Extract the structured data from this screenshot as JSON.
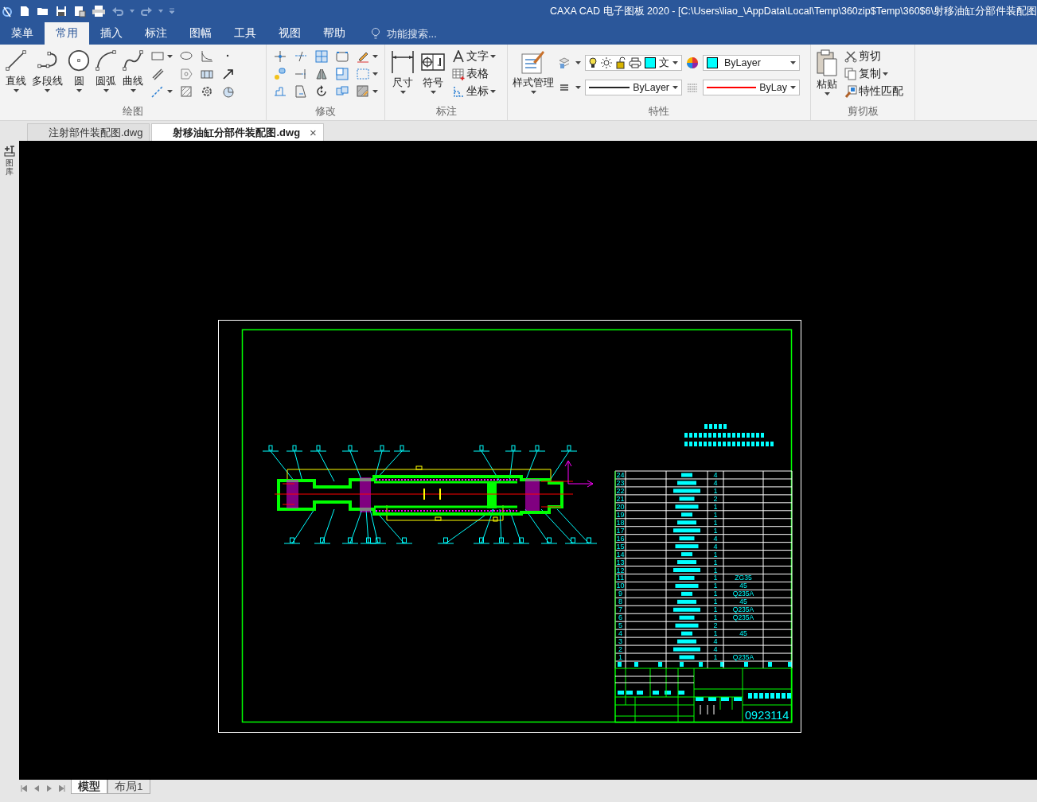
{
  "window": {
    "title": "CAXA CAD 电子图板 2020 - [C:\\Users\\liao_\\AppData\\Local\\Temp\\360zip$Temp\\360$6\\射移油缸分部件装配图"
  },
  "ribbon_tabs": [
    {
      "label": "菜单",
      "selected": false
    },
    {
      "label": "常用",
      "selected": true
    },
    {
      "label": "插入",
      "selected": false
    },
    {
      "label": "标注",
      "selected": false
    },
    {
      "label": "图幅",
      "selected": false
    },
    {
      "label": "工具",
      "selected": false
    },
    {
      "label": "视图",
      "selected": false
    },
    {
      "label": "帮助",
      "selected": false
    }
  ],
  "search": {
    "placeholder": "功能搜索..."
  },
  "draw_group": {
    "label": "绘图",
    "tools": [
      "直线",
      "多段线",
      "圆",
      "圆弧",
      "曲线"
    ]
  },
  "modify_group": {
    "label": "修改"
  },
  "annotate_group": {
    "label": "标注",
    "tools": [
      "尺寸",
      "符号"
    ],
    "small_tools": [
      "文字",
      "表格",
      "坐标"
    ]
  },
  "properties_group": {
    "label": "特性",
    "tools": [
      "样式管理"
    ],
    "layer": {
      "value": "文",
      "color": "#00ffff"
    },
    "color": {
      "value": "ByLayer",
      "color": "#00ffff"
    },
    "linetype": {
      "value": "ByLayer"
    },
    "lineweight": {
      "value": "ByLay",
      "color": "#ff0000"
    }
  },
  "clipboard_group": {
    "label": "剪切板",
    "tools": [
      "粘贴"
    ],
    "small_tools": [
      "剪切",
      "复制",
      "特性匹配"
    ]
  },
  "document_tabs": [
    {
      "label": "注射部件装配图.dwg",
      "selected": false
    },
    {
      "label": "射移油缸分部件装配图.dwg",
      "selected": true,
      "close": "×"
    }
  ],
  "side_panel": {
    "label": "图库"
  },
  "parts_list": {
    "rows": [
      {
        "no": "24",
        "qty": "4"
      },
      {
        "no": "23",
        "qty": "4"
      },
      {
        "no": "22",
        "qty": "1"
      },
      {
        "no": "21",
        "qty": "2"
      },
      {
        "no": "20",
        "qty": "1"
      },
      {
        "no": "19",
        "qty": "1"
      },
      {
        "no": "18",
        "qty": "1"
      },
      {
        "no": "17",
        "qty": "1"
      },
      {
        "no": "16",
        "qty": "4"
      },
      {
        "no": "15",
        "qty": "4"
      },
      {
        "no": "14",
        "qty": "1"
      },
      {
        "no": "13",
        "qty": "1"
      },
      {
        "no": "12",
        "qty": "1"
      },
      {
        "no": "11",
        "qty": "1",
        "material": "ZG35"
      },
      {
        "no": "10",
        "qty": "1",
        "material": "45"
      },
      {
        "no": "9",
        "qty": "1",
        "material": "Q235A"
      },
      {
        "no": "8",
        "qty": "1",
        "material": "45"
      },
      {
        "no": "7",
        "qty": "1",
        "material": "Q235A"
      },
      {
        "no": "6",
        "qty": "1",
        "material": "Q235A"
      },
      {
        "no": "5",
        "qty": "2"
      },
      {
        "no": "4",
        "qty": "1",
        "material": "45"
      },
      {
        "no": "3",
        "qty": "4"
      },
      {
        "no": "2",
        "qty": "4"
      },
      {
        "no": "1",
        "qty": "1",
        "material": "Q235A"
      }
    ]
  },
  "title_block": {
    "drawing_number": "0923114"
  },
  "layout_tabs": [
    {
      "label": "模型",
      "selected": true
    },
    {
      "label": "布局1",
      "selected": false
    }
  ]
}
